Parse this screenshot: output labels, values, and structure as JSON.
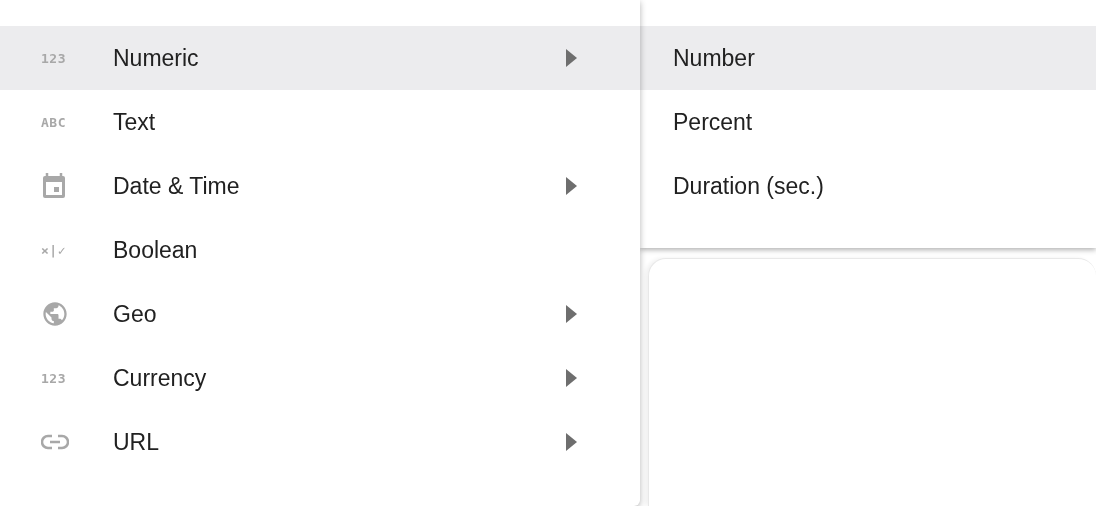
{
  "type_menu": {
    "items": [
      {
        "label": "Numeric",
        "icon": {
          "kind": "glyph",
          "text": "123"
        },
        "submenu": true,
        "selected": true
      },
      {
        "label": "Text",
        "icon": {
          "kind": "glyph",
          "text": "ABC"
        },
        "submenu": false,
        "selected": false
      },
      {
        "label": "Date & Time",
        "icon": {
          "kind": "calendar"
        },
        "submenu": true,
        "selected": false
      },
      {
        "label": "Boolean",
        "icon": {
          "kind": "glyph",
          "text": "×|✓"
        },
        "submenu": false,
        "selected": false
      },
      {
        "label": "Geo",
        "icon": {
          "kind": "globe"
        },
        "submenu": true,
        "selected": false
      },
      {
        "label": "Currency",
        "icon": {
          "kind": "glyph",
          "text": "123"
        },
        "submenu": true,
        "selected": false
      },
      {
        "label": "URL",
        "icon": {
          "kind": "link"
        },
        "submenu": true,
        "selected": false
      }
    ]
  },
  "submenu": {
    "items": [
      {
        "label": "Number",
        "selected": true
      },
      {
        "label": "Percent",
        "selected": false
      },
      {
        "label": "Duration (sec.)",
        "selected": false
      }
    ]
  }
}
